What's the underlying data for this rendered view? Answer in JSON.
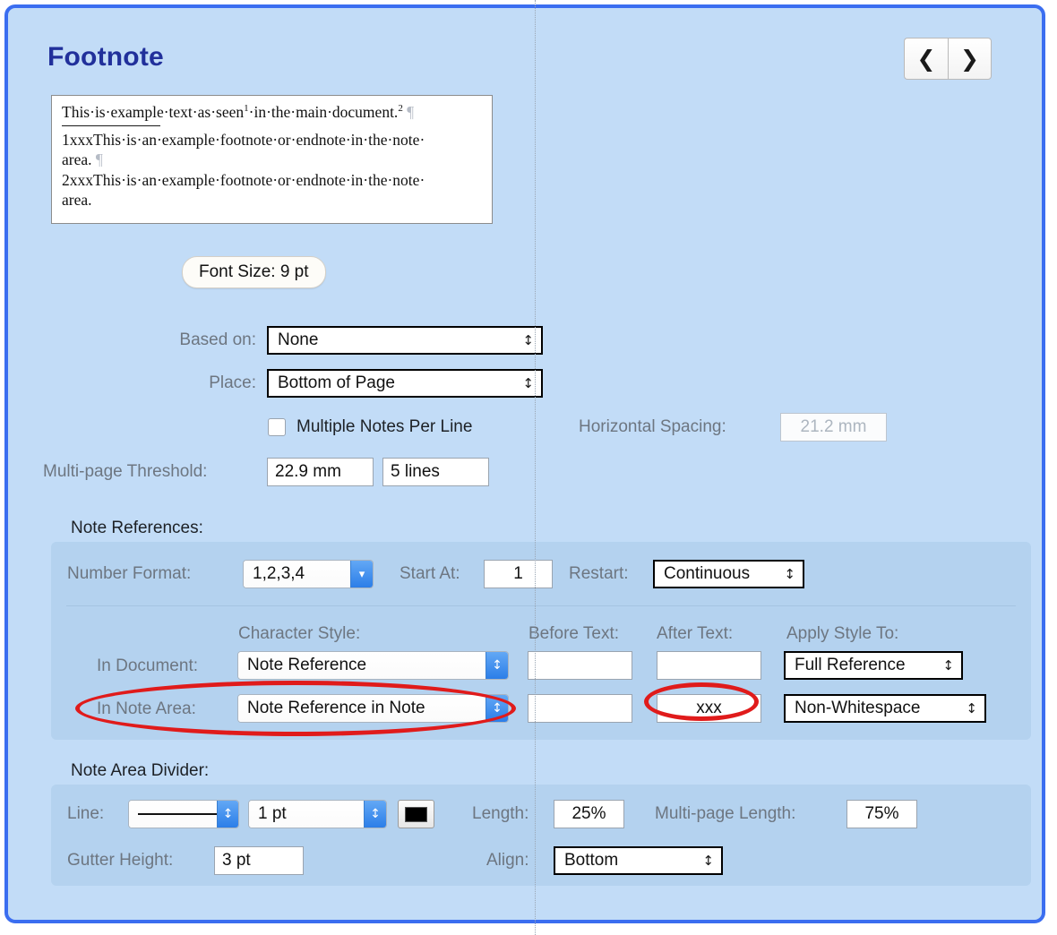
{
  "window": {
    "title": "Footnote",
    "accent_border_color": "#3b6ef0",
    "background_color": "#c2dcf7",
    "panel_color": "#b4d2ef",
    "title_color": "#21309b",
    "annotation_color": "#e01b1b"
  },
  "nav": {
    "prev_label": "‹",
    "prev_name": "chevron-left-icon",
    "next_label": "›",
    "next_name": "chevron-right-icon"
  },
  "preview": {
    "document_line": {
      "prefix": "This",
      "text": "This·is·example·text·as·seen",
      "sup1": "1",
      "mid": "·in·the·main·document.",
      "sup2": "2",
      "pilcrow": "¶"
    },
    "note_lines": [
      "1xxxThis·is·an·example·footnote·or·endnote·in·the·note·",
      "area.",
      "2xxxThis·is·an·example·footnote·or·endnote·in·the·note·",
      "area."
    ],
    "note_pilcrow": "¶"
  },
  "font_size_pill": {
    "label": "Font Size: 9 pt"
  },
  "based_on": {
    "label": "Based on:",
    "value": "None"
  },
  "place": {
    "label": "Place:",
    "value": "Bottom of Page"
  },
  "multiple_notes": {
    "label": "Multiple Notes Per Line",
    "checked": false
  },
  "horizontal_spacing": {
    "label": "Horizontal Spacing:",
    "value": "21.2 mm",
    "disabled": true
  },
  "multipage_threshold": {
    "label": "Multi-page Threshold:",
    "value_mm": "22.9 mm",
    "value_lines": "5 lines"
  },
  "note_references": {
    "section_label": "Note References:",
    "number_format": {
      "label": "Number Format:",
      "value": "1,2,3,4"
    },
    "start_at": {
      "label": "Start At:",
      "value": "1"
    },
    "restart": {
      "label": "Restart:",
      "value": "Continuous"
    },
    "columns": {
      "character_style": "Character Style:",
      "before_text": "Before Text:",
      "after_text": "After Text:",
      "apply_style_to": "Apply Style To:"
    },
    "rows": [
      {
        "label": "In Document:",
        "character_style": "Note Reference",
        "before_text": "",
        "after_text": "",
        "apply_style_to": "Full Reference"
      },
      {
        "label": "In Note Area:",
        "character_style": "Note Reference in Note",
        "before_text": "",
        "after_text": "xxx",
        "apply_style_to": "Non-Whitespace"
      }
    ]
  },
  "note_area_divider": {
    "section_label": "Note Area Divider:",
    "line": {
      "label": "Line:",
      "style_value": "solid-line",
      "width_value": "1 pt",
      "color_value": "#000000"
    },
    "length": {
      "label": "Length:",
      "value": "25%"
    },
    "multipage_length": {
      "label": "Multi-page Length:",
      "value": "75%"
    },
    "gutter_height": {
      "label": "Gutter Height:",
      "value": "3 pt"
    },
    "align": {
      "label": "Align:",
      "value": "Bottom"
    }
  },
  "icons": {
    "stepper_updown": "⇅",
    "chevron_updown": "⌃⌄",
    "combo_chevron_down": "⌄"
  }
}
